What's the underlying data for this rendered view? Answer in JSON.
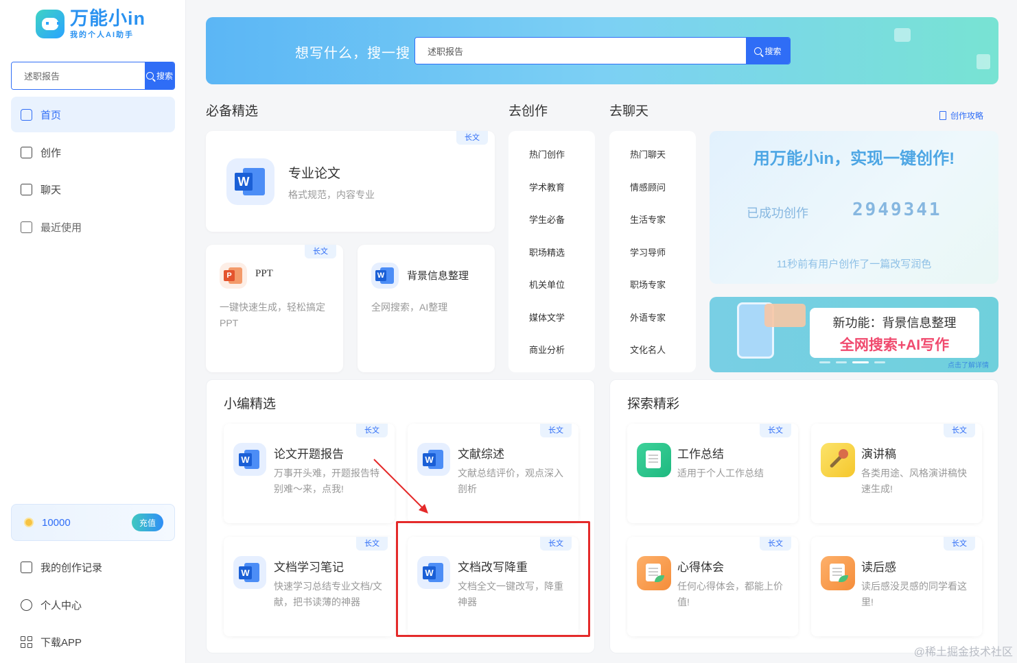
{
  "app": {
    "logo_title": "万能小in",
    "logo_sub": "我的个人AI助手"
  },
  "sidebar": {
    "search_value": "述职报告",
    "search_button": "搜索",
    "nav": [
      {
        "label": "首页",
        "icon": "home-icon",
        "active": true
      },
      {
        "label": "创作",
        "icon": "edit-icon",
        "active": false
      },
      {
        "label": "聊天",
        "icon": "chat-icon",
        "active": false
      },
      {
        "label": "最近使用",
        "icon": "history-icon",
        "active": false
      }
    ],
    "credits": "10000",
    "recharge": "充值",
    "bottom": [
      {
        "label": "我的创作记录",
        "icon": "record-icon"
      },
      {
        "label": "个人中心",
        "icon": "user-icon"
      },
      {
        "label": "下载APP",
        "icon": "grid-icon"
      }
    ]
  },
  "banner": {
    "title": "想写什么，搜一搜",
    "search_value": "述职报告",
    "search_button": "搜索"
  },
  "sections": {
    "essentials": "必备精选",
    "create": "去创作",
    "chat": "去聊天",
    "guide": "创作攻略",
    "editor_pick": "小编精选",
    "explore": "探索精彩"
  },
  "tag_long": "长文",
  "essentials": {
    "paper": {
      "title": "专业论文",
      "desc": "格式规范，内容专业"
    },
    "ppt": {
      "title": "PPT",
      "desc": "一键快速生成，轻松搞定PPT"
    },
    "background": {
      "title": "背景信息整理",
      "desc": "全网搜索，AI整理"
    }
  },
  "create_list": [
    "热门创作",
    "学术教育",
    "学生必备",
    "职场精选",
    "机关单位",
    "媒体文学",
    "商业分析"
  ],
  "chat_list": [
    "热门聊天",
    "情感顾问",
    "生活专家",
    "学习导师",
    "职场专家",
    "外语专家",
    "文化名人"
  ],
  "stat": {
    "headline": "用万能小in，实现一键创作!",
    "label": "已成功创作",
    "count": "2949341",
    "footer": "11秒前有用户创作了一篇改写润色"
  },
  "promo": {
    "line1": "新功能：背景信息整理",
    "line2": "全网搜索+AI写作",
    "more": "点击了解详情"
  },
  "editor_cards": [
    {
      "title": "论文开题报告",
      "desc": "万事开头难，开题报告特别难～来，点我!"
    },
    {
      "title": "文献综述",
      "desc": "文献总结评价，观点深入剖析"
    },
    {
      "title": "文档学习笔记",
      "desc": "快速学习总结专业文档/文献，把书读薄的神器"
    },
    {
      "title": "文档改写降重",
      "desc": "文档全文一键改写，降重神器"
    }
  ],
  "explore_cards": [
    {
      "title": "工作总结",
      "desc": "适用于个人工作总结"
    },
    {
      "title": "演讲稿",
      "desc": "各类用途、风格演讲稿快速生成!"
    },
    {
      "title": "心得体会",
      "desc": "任何心得体会，都能上价值!"
    },
    {
      "title": "读后感",
      "desc": "读后感没灵感的同学看这里!"
    }
  ],
  "watermark": "@稀土掘金技术社区",
  "colors": {
    "accent": "#2f6df6",
    "annotation": "#e42a2a"
  }
}
